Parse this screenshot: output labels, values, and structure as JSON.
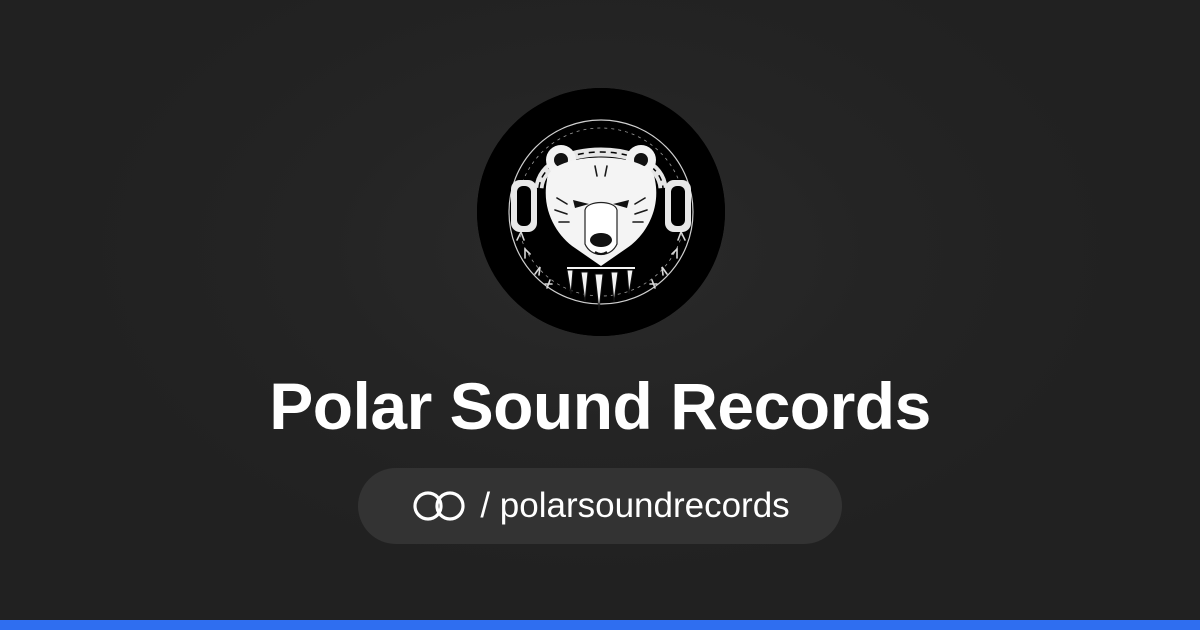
{
  "profile": {
    "name": "Polar Sound Records",
    "handle": "/ polarsoundrecords",
    "avatar_icon": "bear-headphones-logo-icon"
  },
  "brand": {
    "link_icon": "linked-rings-icon",
    "accent_color": "#2f6ef0",
    "background_color": "#222222",
    "pill_color": "#333333"
  }
}
